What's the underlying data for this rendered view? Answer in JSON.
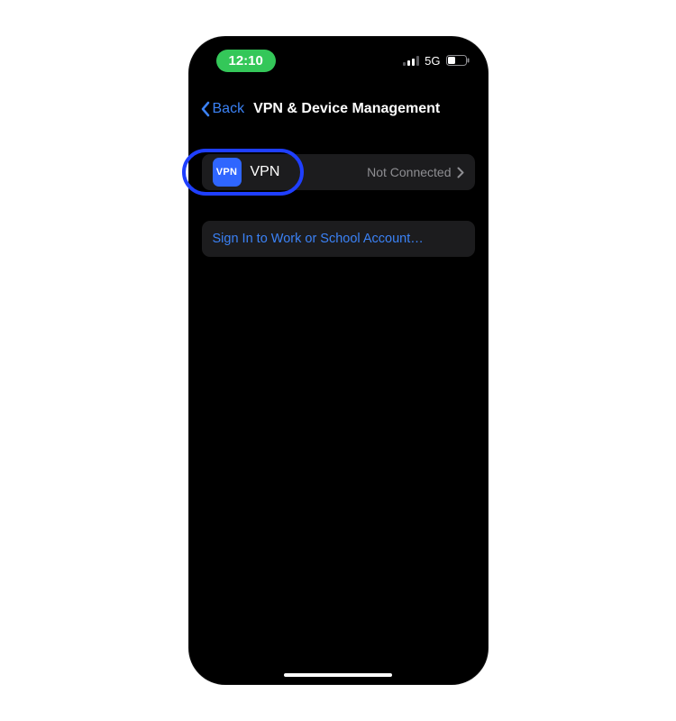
{
  "statusbar": {
    "time": "12:10",
    "network_label": "5G"
  },
  "nav": {
    "back_label": "Back",
    "title": "VPN & Device Management"
  },
  "vpn_row": {
    "icon_text": "VPN",
    "label": "VPN",
    "status": "Not Connected"
  },
  "signin": {
    "label": "Sign In to Work or School Account…"
  }
}
